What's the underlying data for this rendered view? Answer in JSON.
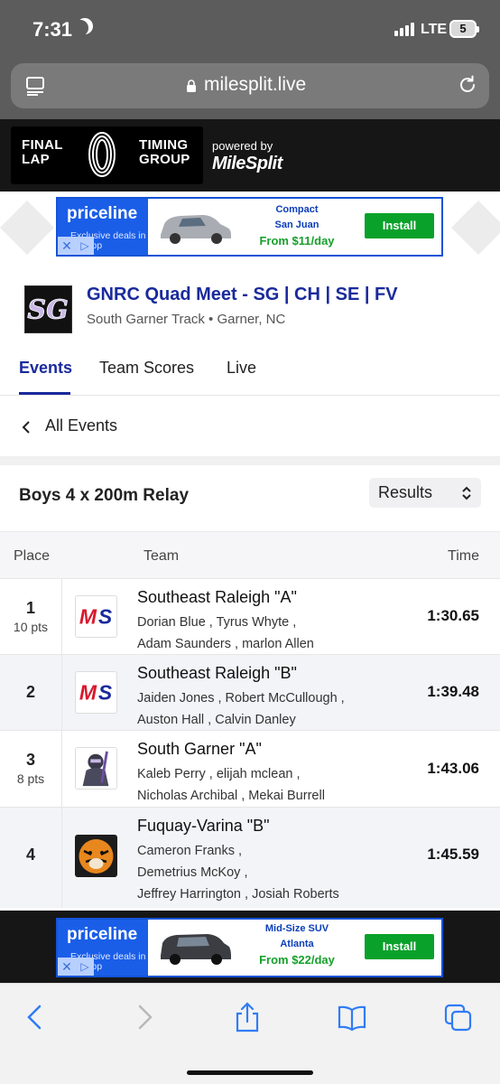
{
  "status_bar": {
    "time": "7:31",
    "network": "LTE",
    "battery": "5"
  },
  "browser": {
    "url": "milesplit.live"
  },
  "header": {
    "logo_left": "FINAL\nLAP",
    "logo_right": "TIMING\nGROUP",
    "powered_by": "powered by",
    "milesplit": "MileSplit"
  },
  "ads": [
    {
      "brand": "priceline",
      "sub": "Exclusive deals in the app",
      "car_type": "Compact",
      "city": "San Juan",
      "price": "From $11/day",
      "cta": "Install"
    },
    {
      "brand": "priceline",
      "sub": "Exclusive deals in the app",
      "car_type": "Mid-Size SUV",
      "city": "Atlanta",
      "price": "From $22/day",
      "cta": "Install"
    }
  ],
  "meet": {
    "title": "GNRC Quad Meet - SG | CH | SE | FV",
    "location": "South Garner Track • Garner, NC"
  },
  "tabs": [
    {
      "label": "Events",
      "active": true
    },
    {
      "label": "Team Scores",
      "active": false
    },
    {
      "label": "Live",
      "active": false
    }
  ],
  "back_link": "All Events",
  "event": {
    "title": "Boys 4 x 200m Relay",
    "view_select": "Results"
  },
  "table": {
    "headers": {
      "place": "Place",
      "team": "Team",
      "time": "Time"
    },
    "rows": [
      {
        "place": "1",
        "points": "10 pts",
        "team": "Southeast Raleigh \"A\"",
        "logo": "milesplit-ms",
        "athletes_line1": "Dorian Blue , Tyrus Whyte ,",
        "athletes_line2": "Adam Saunders , marlon Allen",
        "athletes_line3": "",
        "time": "1:30.65"
      },
      {
        "place": "2",
        "points": "",
        "team": "Southeast Raleigh \"B\"",
        "logo": "milesplit-ms",
        "athletes_line1": "Jaiden Jones , Robert McCullough ,",
        "athletes_line2": "Auston Hall , Calvin Danley",
        "athletes_line3": "",
        "time": "1:39.48"
      },
      {
        "place": "3",
        "points": "8 pts",
        "team": "South Garner \"A\"",
        "logo": "knight",
        "athletes_line1": "Kaleb Perry , elijah mclean ,",
        "athletes_line2": "Nicholas Archibal , Mekai Burrell",
        "athletes_line3": "",
        "time": "1:43.06"
      },
      {
        "place": "4",
        "points": "",
        "team": "Fuquay-Varina \"B\"",
        "logo": "tiger",
        "athletes_line1": "Cameron Franks ,",
        "athletes_line2": "Demetrius McKoy ,",
        "athletes_line3": "Jeffrey Harrington , Josiah Roberts",
        "time": "1:45.59"
      }
    ]
  },
  "colors": {
    "brand_navy": "#1a2a9c",
    "priceline_blue": "#1a5ee8",
    "install_green": "#0aa12a",
    "milesplit_red": "#d7192d"
  }
}
